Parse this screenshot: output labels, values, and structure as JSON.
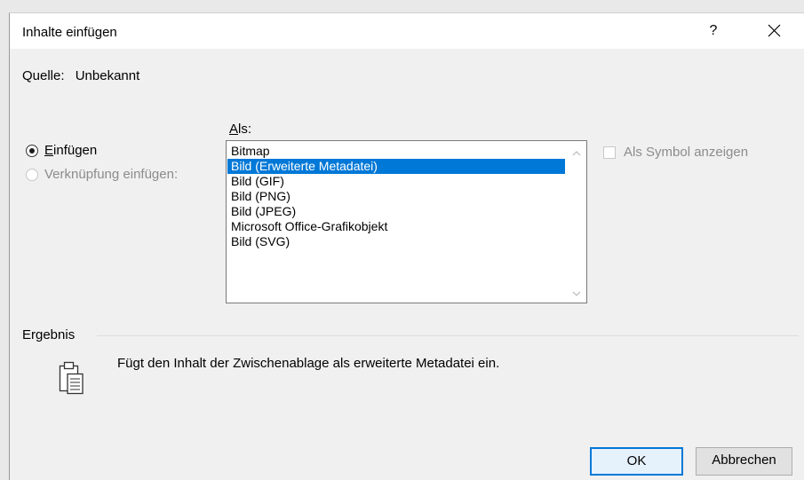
{
  "dialog": {
    "title": "Inhalte einfügen",
    "help_label": "?",
    "source_label": "Quelle:",
    "source_value": "Unbekannt"
  },
  "options": {
    "paste_prefix": "E",
    "paste_rest": "infügen",
    "link_label": "Verknüpfung einfügen:",
    "selected": "paste"
  },
  "as": {
    "label_prefix": "A",
    "label_rest": "ls:",
    "items": [
      "Bitmap",
      "Bild (Erweiterte Metadatei)",
      "Bild (GIF)",
      "Bild (PNG)",
      "Bild (JPEG)",
      "Microsoft Office-Grafikobjekt",
      "Bild (SVG)"
    ],
    "selected_index": 1
  },
  "symbol": {
    "label": "Als Symbol anzeigen",
    "checked": false,
    "enabled": false
  },
  "result": {
    "label": "Ergebnis",
    "text": "Fügt den Inhalt der Zwischenablage als erweiterte Metadatei ein."
  },
  "buttons": {
    "ok": "OK",
    "cancel": "Abbrechen"
  },
  "colors": {
    "selection": "#0078d7",
    "dialog_bg": "#f0f0f0",
    "disabled_text": "#8c8c8c"
  }
}
